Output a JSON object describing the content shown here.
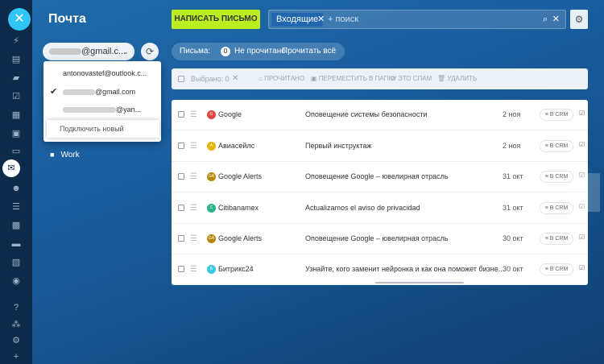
{
  "app": {
    "title": "Почта"
  },
  "toolbar": {
    "write_label": "НАПИСАТЬ ПИСЬМО",
    "filter_chip": "Входящие",
    "search_placeholder": "+ поиск"
  },
  "account": {
    "selected_suffix": "@gmail.c...",
    "dropdown": {
      "items": [
        {
          "label": "antonovastef@outlook.c...",
          "checked": false,
          "masked": false
        },
        {
          "label": "@gmail.com",
          "checked": true,
          "masked": true
        },
        {
          "label": "@yan...",
          "checked": false,
          "masked": true
        }
      ],
      "connect_label": "Подключить новый"
    }
  },
  "folders": [
    {
      "label": "Work"
    }
  ],
  "filters": {
    "label": "Письма:",
    "unread_count": "0",
    "unread_label": "Не прочитано",
    "read_all_label": "Прочитать всё"
  },
  "actions": {
    "selected": "Выбрано: 0",
    "read": "ПРОЧИТАНО",
    "move": "ПЕРЕМЕСТИТЬ В ПАПКУ",
    "spam": "ЭТО СПАМ",
    "delete": "УДАЛИТЬ"
  },
  "messages": [
    {
      "avatar": "G",
      "avatar_color": "#e0473f",
      "sender": "Google",
      "subject": "Оповещение системы безопасности",
      "date": "2 ноя",
      "crm": "В CRM"
    },
    {
      "avatar": "А",
      "avatar_color": "#e6b400",
      "sender": "Авиасейлс",
      "subject": "Первый инструктаж",
      "date": "2 ноя",
      "crm": "В CRM"
    },
    {
      "avatar": "GA",
      "avatar_color": "#b8860b",
      "sender": "Google Alerts",
      "subject": "Оповещение Google – ювелирная отрасль",
      "date": "31 окт",
      "crm": "В CRM"
    },
    {
      "avatar": "C",
      "avatar_color": "#2bb38a",
      "sender": "Citibanamex",
      "subject": "Actualizamos el aviso de privacidad",
      "date": "31 окт",
      "crm": "В CRM"
    },
    {
      "avatar": "GA",
      "avatar_color": "#b8860b",
      "sender": "Google Alerts",
      "subject": "Оповещение Google – ювелирная отрасль",
      "date": "30 окт",
      "crm": "В CRM"
    },
    {
      "avatar": "Б",
      "avatar_color": "#3bc8e0",
      "sender": "Битрикс24",
      "subject": "Узнайте, кого заменит нейронка и как она поможет бизне...",
      "date": "30 окт",
      "crm": "В CRM"
    }
  ],
  "colors": {
    "accent": "#bbed21",
    "chip": "#2067b0",
    "rail": "#0e2a4a"
  }
}
